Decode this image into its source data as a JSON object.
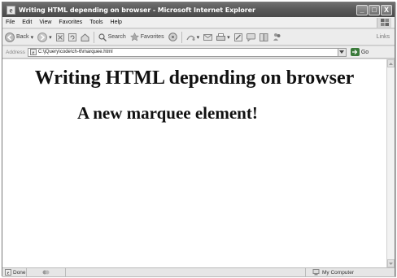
{
  "window": {
    "title": "Writing HTML depending on browser - Microsoft Internet Explorer",
    "minimize": "_",
    "maximize": "□",
    "close": "X"
  },
  "menu": {
    "items": [
      "File",
      "Edit",
      "View",
      "Favorites",
      "Tools",
      "Help"
    ]
  },
  "toolbar": {
    "back_label": "Back",
    "search_label": "Search",
    "favorites_label": "Favorites",
    "links_label": "Links"
  },
  "address": {
    "label": "Address",
    "url": "C:\\jQuery\\code\\ch-6\\marquee.html",
    "go_label": "Go"
  },
  "content": {
    "heading1": "Writing HTML depending on browser",
    "heading2": "A new marquee element!"
  },
  "status": {
    "text": "Done",
    "zone": "My Computer"
  },
  "colors": {
    "titlebar": "#5a5a5a",
    "content_bg": "#ffffff",
    "heading": "#111111"
  },
  "icons": {
    "back": "back-arrow-icon",
    "forward": "forward-arrow-icon",
    "stop": "stop-icon",
    "refresh": "refresh-icon",
    "home": "home-icon",
    "search": "search-icon",
    "favorites": "star-icon",
    "media": "media-icon",
    "history": "history-icon",
    "mail": "mail-icon",
    "print": "print-icon",
    "edit": "edit-icon",
    "discuss": "discuss-icon",
    "messenger": "messenger-icon"
  }
}
